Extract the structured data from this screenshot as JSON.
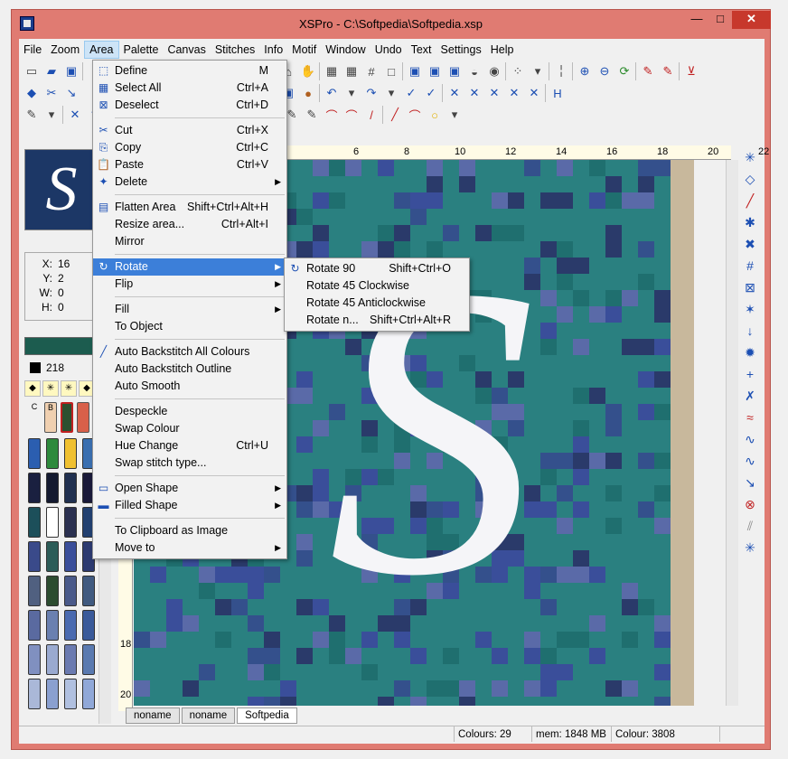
{
  "window": {
    "title": "XSPro - C:\\Softpedia\\Softpedia.xsp",
    "minimize": "—",
    "maximize": "□",
    "close": "✕"
  },
  "menubar": [
    "File",
    "Zoom",
    "Area",
    "Palette",
    "Canvas",
    "Stitches",
    "Info",
    "Motif",
    "Window",
    "Undo",
    "Text",
    "Settings",
    "Help"
  ],
  "coords": {
    "x_label": "X:",
    "x": "16",
    "y_label": "Y:",
    "y": "2",
    "w_label": "W:",
    "w": "0",
    "h_label": "H:",
    "h": "0"
  },
  "colour_number": "218",
  "palette_header": [
    "C",
    "B"
  ],
  "palette_colors": [
    "#2b5eb0",
    "#2e8a3c",
    "#f0c030",
    "#3a6fb0",
    "#1a2040",
    "#141a30",
    "#203050",
    "#1a1a3a",
    "#1c4f5a",
    "#ffffff",
    "#2a3050",
    "#224070",
    "#3a4a8a",
    "#2c5c58",
    "#3a4e9a",
    "#2c3a70",
    "#506080",
    "#2c4c30",
    "#4a5a8a",
    "#405a80",
    "#5a6aa0",
    "#6a80b0",
    "#4a6ab0",
    "#3a5a9a",
    "#8090c0",
    "#9aaad0",
    "#6a7ab0",
    "#5a7ab0",
    "#aab8d8",
    "#8aa0d0",
    "#b0c0e0",
    "#90a8d8"
  ],
  "ruler_top": [
    "6",
    "8",
    "10",
    "12",
    "14",
    "16",
    "18",
    "20",
    "22"
  ],
  "ruler_left": [
    "18",
    "20"
  ],
  "tabs": [
    "noname",
    "noname",
    "Softpedia"
  ],
  "status": {
    "colours": "Colours: 29",
    "mem": "mem: 1848 MB",
    "colour": "Colour: 3808"
  },
  "area_menu": [
    {
      "label": "Define",
      "shortcut": "M",
      "icon": "define-icon"
    },
    {
      "label": "Select All",
      "shortcut": "Ctrl+A",
      "icon": "select-all-icon"
    },
    {
      "label": "Deselect",
      "shortcut": "Ctrl+D",
      "icon": "deselect-icon"
    },
    {
      "sep": true
    },
    {
      "label": "Cut",
      "shortcut": "Ctrl+X",
      "icon": "scissors-icon"
    },
    {
      "label": "Copy",
      "shortcut": "Ctrl+C",
      "icon": "copy-icon"
    },
    {
      "label": "Paste",
      "shortcut": "Ctrl+V",
      "icon": "paste-icon"
    },
    {
      "label": "Delete",
      "shortcut": "",
      "icon": "delete-icon",
      "sub": true
    },
    {
      "sep": true
    },
    {
      "label": "Flatten Area",
      "shortcut": "Shift+Ctrl+Alt+H",
      "icon": "flatten-icon"
    },
    {
      "label": "Resize area...",
      "shortcut": "Ctrl+Alt+I",
      "icon": ""
    },
    {
      "label": "Mirror",
      "shortcut": "",
      "icon": ""
    },
    {
      "sep": true
    },
    {
      "label": "Rotate",
      "shortcut": "",
      "icon": "rotate-icon",
      "sub": true,
      "hl": true
    },
    {
      "label": "Flip",
      "shortcut": "",
      "icon": "",
      "sub": true
    },
    {
      "sep": true
    },
    {
      "label": "Fill",
      "shortcut": "",
      "icon": "",
      "sub": true
    },
    {
      "label": "To Object",
      "shortcut": "",
      "icon": ""
    },
    {
      "sep": true
    },
    {
      "label": "Auto Backstitch All Colours",
      "shortcut": "",
      "icon": "backstitch-icon"
    },
    {
      "label": "Auto Backstitch Outline",
      "shortcut": "",
      "icon": ""
    },
    {
      "label": "Auto Smooth",
      "shortcut": "",
      "icon": ""
    },
    {
      "sep": true
    },
    {
      "label": "Despeckle",
      "shortcut": "",
      "icon": ""
    },
    {
      "label": "Swap Colour",
      "shortcut": "",
      "icon": ""
    },
    {
      "label": "Hue Change",
      "shortcut": "Ctrl+U",
      "icon": ""
    },
    {
      "label": "Swap stitch type...",
      "shortcut": "",
      "icon": ""
    },
    {
      "sep": true
    },
    {
      "label": "Open Shape",
      "shortcut": "",
      "icon": "open-shape-icon",
      "sub": true
    },
    {
      "label": "Filled Shape",
      "shortcut": "",
      "icon": "filled-shape-icon",
      "sub": true
    },
    {
      "sep": true
    },
    {
      "label": "To Clipboard as Image",
      "shortcut": "",
      "icon": ""
    },
    {
      "label": "Move to",
      "shortcut": "",
      "icon": "",
      "sub": true
    }
  ],
  "rotate_submenu": [
    {
      "label": "Rotate 90",
      "shortcut": "Shift+Ctrl+O",
      "icon": "rotate-90-icon"
    },
    {
      "label": "Rotate 45 Clockwise",
      "shortcut": "",
      "icon": ""
    },
    {
      "label": "Rotate 45 Anticlockwise",
      "shortcut": "",
      "icon": ""
    },
    {
      "label": "Rotate n...",
      "shortcut": "Shift+Ctrl+Alt+R",
      "icon": ""
    }
  ],
  "colors": {
    "title_bar": "#e07b72",
    "highlight": "#3c7fd9",
    "canvas_teal": "#2a8080"
  }
}
